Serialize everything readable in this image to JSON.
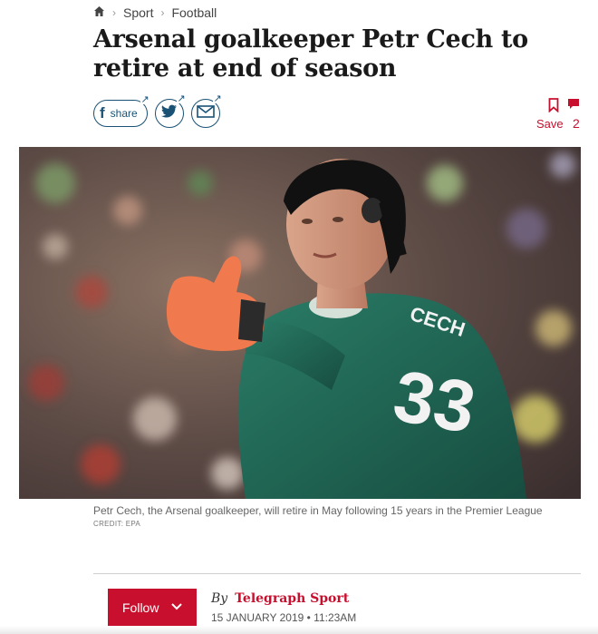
{
  "breadcrumb": {
    "items": [
      "Sport",
      "Football"
    ]
  },
  "article": {
    "headline": "Arsenal goalkeeper Petr Cech to retire at end of season",
    "image_caption": "Petr Cech, the Arsenal goalkeeper, will retire in May following 15 years in the Premier League",
    "image_credit": "CREDIT: EPA",
    "shirt_name": "CECH",
    "shirt_number": "33"
  },
  "share": {
    "share_label": "share",
    "save_label": "Save",
    "comment_count": "2"
  },
  "byline": {
    "by": "By",
    "author": "Telegraph Sport",
    "date": "15 JANUARY 2019 • 11:23AM",
    "follow_label": "Follow"
  },
  "colors": {
    "accent": "#c8102e",
    "share_blue": "#1a5276",
    "kit_green": "#1f6b58"
  },
  "icons": [
    "home-icon",
    "facebook-icon",
    "twitter-icon",
    "email-icon",
    "bookmark-icon",
    "comment-icon",
    "chevron-down-icon"
  ]
}
